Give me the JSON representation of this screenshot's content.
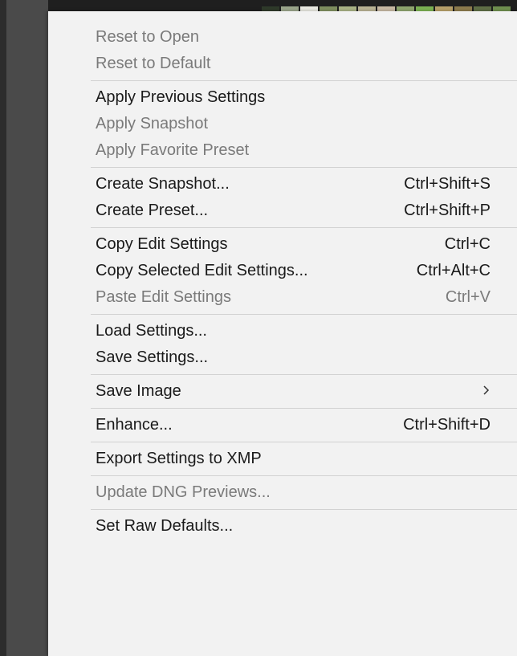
{
  "colors": {
    "menu_bg": "#f2f2f2",
    "text_enabled": "#1a1a1a",
    "text_disabled": "#7a7a7a",
    "separator": "#d2d2d2"
  },
  "menu": {
    "groups": [
      [
        {
          "label": "Reset to Open",
          "shortcut": "",
          "enabled": false
        },
        {
          "label": "Reset to Default",
          "shortcut": "",
          "enabled": false
        }
      ],
      [
        {
          "label": "Apply Previous Settings",
          "shortcut": "",
          "enabled": true
        },
        {
          "label": "Apply Snapshot",
          "shortcut": "",
          "enabled": false
        },
        {
          "label": "Apply Favorite Preset",
          "shortcut": "",
          "enabled": false
        }
      ],
      [
        {
          "label": "Create Snapshot...",
          "shortcut": "Ctrl+Shift+S",
          "enabled": true
        },
        {
          "label": "Create Preset...",
          "shortcut": "Ctrl+Shift+P",
          "enabled": true
        }
      ],
      [
        {
          "label": "Copy Edit Settings",
          "shortcut": "Ctrl+C",
          "enabled": true
        },
        {
          "label": "Copy Selected Edit Settings...",
          "shortcut": "Ctrl+Alt+C",
          "enabled": true
        },
        {
          "label": "Paste Edit Settings",
          "shortcut": "Ctrl+V",
          "enabled": false
        }
      ],
      [
        {
          "label": "Load Settings...",
          "shortcut": "",
          "enabled": true
        },
        {
          "label": "Save Settings...",
          "shortcut": "",
          "enabled": true
        }
      ],
      [
        {
          "label": "Save Image",
          "shortcut": "",
          "enabled": true,
          "submenu": true,
          "submenu_icon": "chevron-right-icon"
        }
      ],
      [
        {
          "label": "Enhance...",
          "shortcut": "Ctrl+Shift+D",
          "enabled": true
        }
      ],
      [
        {
          "label": "Export Settings to XMP",
          "shortcut": "",
          "enabled": true
        }
      ],
      [
        {
          "label": "Update DNG Previews...",
          "shortcut": "",
          "enabled": false
        }
      ],
      [
        {
          "label": "Set Raw Defaults...",
          "shortcut": "",
          "enabled": true
        }
      ]
    ]
  }
}
